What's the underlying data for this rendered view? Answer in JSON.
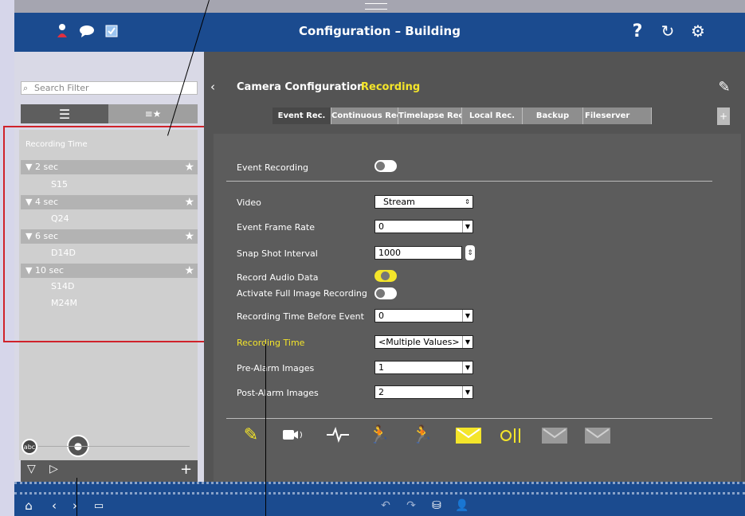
{
  "header": {
    "title": "Configuration – Building",
    "left_icons": [
      "user-icon",
      "chat-icon",
      "checkbox-icon"
    ],
    "right_icons": [
      "help-icon",
      "refresh-icon",
      "settings-icon"
    ]
  },
  "sidebar": {
    "search_placeholder": "Search Filter",
    "list_header": "Recording Time",
    "groups": [
      {
        "label": "2 sec",
        "items": [
          "S15"
        ]
      },
      {
        "label": "4 sec",
        "items": [
          "Q24"
        ]
      },
      {
        "label": "6 sec",
        "items": [
          "D14D"
        ]
      },
      {
        "label": "10 sec",
        "items": [
          "S14D",
          "M24M"
        ]
      }
    ],
    "footer_icons": [
      "abc-icon",
      "cameras-icon"
    ]
  },
  "main": {
    "breadcrumb": "Camera Configuration",
    "subsection": "Recording",
    "tabs": [
      "Event Rec.",
      "Continuous Rec.",
      "Timelapse Rec.",
      "Local Rec.",
      "Backup",
      "Fileserver"
    ],
    "active_tab": "Event Rec.",
    "fields": {
      "event_recording": "Event Recording",
      "video": "Video",
      "video_value": "Stream",
      "event_frame_rate": "Event Frame Rate",
      "event_frame_rate_value": "0",
      "snap_shot_interval": "Snap Shot Interval",
      "snap_shot_interval_value": "1000",
      "record_audio_data": "Record Audio Data",
      "activate_full_image": "Activate Full Image Recording",
      "recording_time_before": "Recording Time Before Event",
      "recording_time_before_value": "0",
      "recording_time": "Recording Time",
      "recording_time_value": "<Multiple Values>",
      "pre_alarm": "Pre-Alarm Images",
      "pre_alarm_value": "1",
      "post_alarm": "Post-Alarm Images",
      "post_alarm_value": "2"
    },
    "event_icons": [
      "pen-icon",
      "camera-audio-icon",
      "heartbeat-icon",
      "motion-icon",
      "motion-active-icon",
      "email-active-icon",
      "signal-icon",
      "email-icon",
      "email-icon-2"
    ]
  },
  "colors": {
    "accent": "#f4e52a",
    "header": "#1b4b8f",
    "highlight": "#d0222a"
  }
}
